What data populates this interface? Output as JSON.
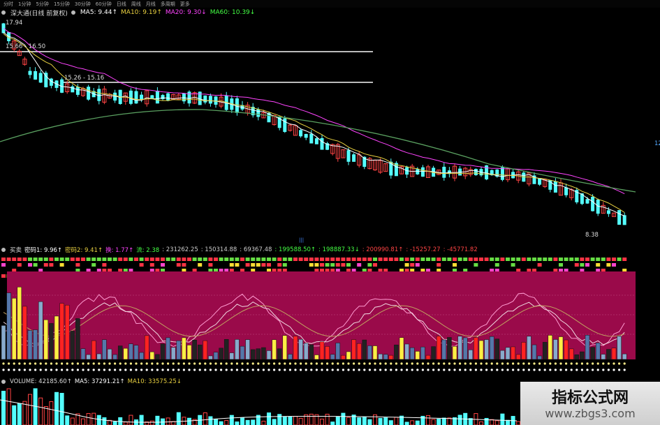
{
  "toolbar": {
    "tabs": [
      "分时",
      "1分钟",
      "5分钟",
      "15分钟",
      "30分钟",
      "60分钟",
      "日线",
      "周线",
      "月线",
      "多周期",
      "更多"
    ]
  },
  "header": {
    "stock": "深大通(日线 前复权)",
    "ma5": "MA5: 9.44↑",
    "ma10": "MA10: 9.19↑",
    "ma20": "MA20: 9.30↓",
    "ma60": "MA60: 10.39↓"
  },
  "price_labels": {
    "high": "17.94",
    "line1": "15.66 - 16.50",
    "line2": "15.26 - 15.16",
    "low": "8.38",
    "right_edge": "12",
    "center_tick": "|||"
  },
  "indicator": {
    "name": "买卖",
    "code1": "密码1: 9.96↑",
    "code2": "密码2: 9.41↑",
    "jian": "换: 1.77↑",
    "liu": "流: 2.38",
    "v1": ": 231262.25",
    "v2": ": 150314.88",
    "v3": ": 69367.48",
    "v4": ": 199588.50↑",
    "v5": ": 198887.33↓",
    "v6": ": 200990.81↑",
    "v7": ": -15257.27",
    "v8": ": -45771.82"
  },
  "volume": {
    "label": "VOLUME: 42185.60↑",
    "ma5": "MA5: 37291.21↑",
    "ma10": "MA10: 33575.25↓"
  },
  "watermark": {
    "logo": "指标公式网",
    "url": "www.zbgs3.com"
  },
  "colors": {
    "up": "#ff4444",
    "down": "#54ffff",
    "ma5": "#ffffff",
    "ma10": "#e8d040",
    "ma20": "#ff44ff",
    "ma60": "#44ff44",
    "panel_bg": "#9a0a4a"
  }
}
